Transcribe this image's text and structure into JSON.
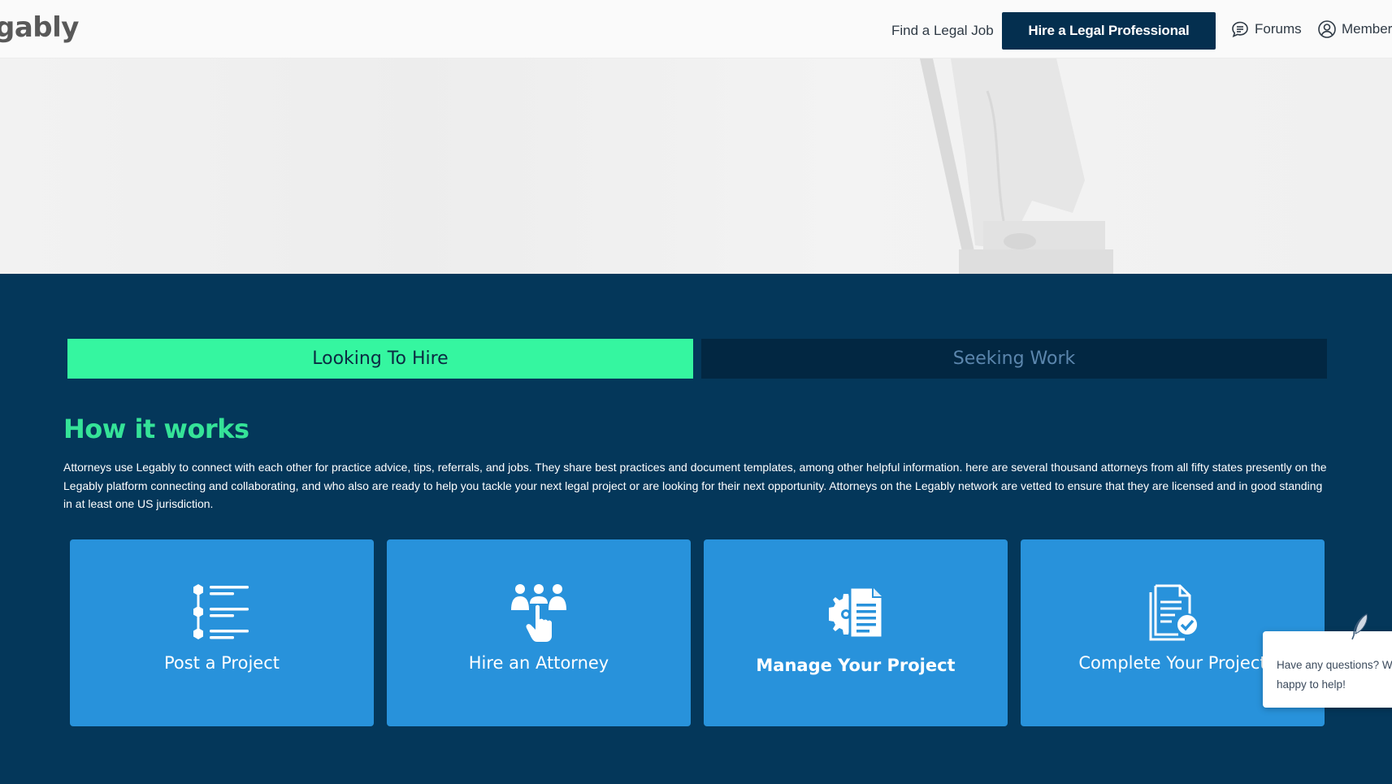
{
  "header": {
    "logo_text": "gably",
    "nav": {
      "find_job": "Find a Legal Job",
      "hire_button": "Hire a Legal Professional",
      "forums": "Forums",
      "members": "Members"
    }
  },
  "tabs": [
    {
      "label": "Looking To Hire",
      "active": true
    },
    {
      "label": "Seeking Work",
      "active": false
    }
  ],
  "how_it_works": {
    "title": "How it works",
    "body": "Attorneys use Legably to connect with each other for practice advice, tips, referrals, and jobs. They share best practices and document templates, among other helpful information. here are several thousand attorneys from all fifty states presently on the Legably platform connecting and collaborating, and who also are ready to help you tackle your next legal project or are looking for their next opportunity. Attorneys on the Legably network are vetted to ensure that they are licensed and in good standing in at least one US jurisdiction."
  },
  "cards": [
    {
      "label": "Post a Project",
      "icon": "project-list-icon"
    },
    {
      "label": "Hire an Attorney",
      "icon": "hire-people-icon"
    },
    {
      "label": "Manage Your Project",
      "icon": "manage-gear-document-icon"
    },
    {
      "label": "Complete Your Project",
      "icon": "document-check-icon"
    }
  ],
  "chat": {
    "message": "Have any questions? We are happy to help!"
  },
  "colors": {
    "section_bg": "#04375a",
    "accent_green": "#35f6a0",
    "card_blue": "#2892db",
    "header_button": "#042f4f"
  }
}
